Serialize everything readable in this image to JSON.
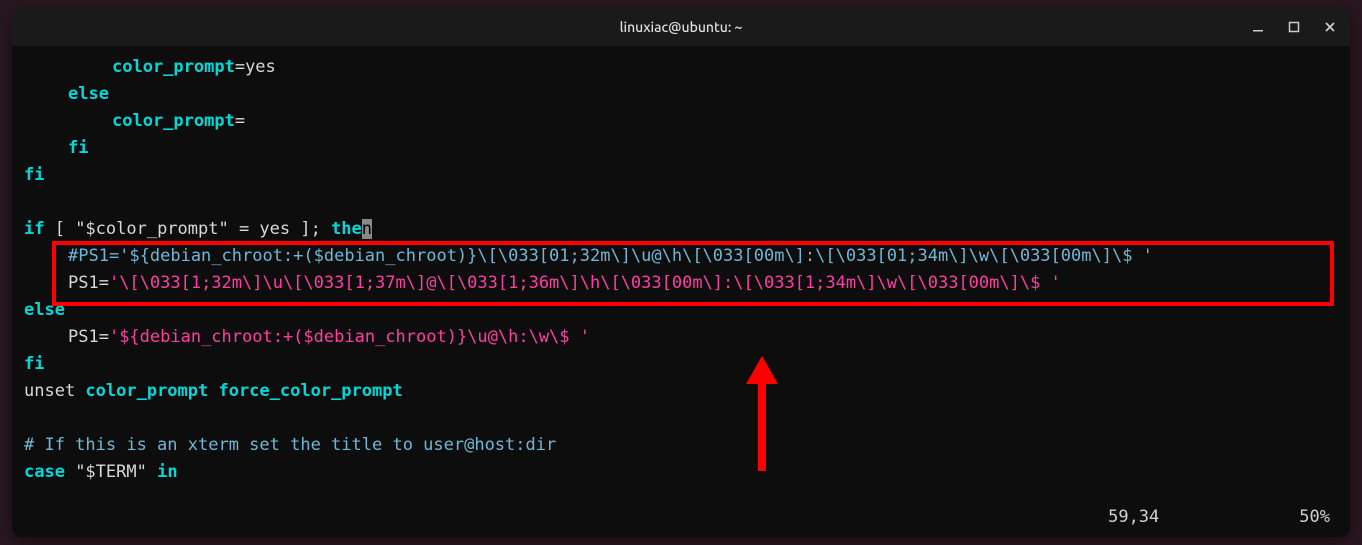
{
  "window": {
    "title": "linuxiac@ubuntu: ~"
  },
  "code": {
    "l1_var": "color_prompt",
    "l1_val": "=yes",
    "l2": "else",
    "l3_var": "color_prompt",
    "l3_val": "=",
    "l4": "fi",
    "l5": "fi",
    "l6_if": "if",
    "l6_cond": " [ \"$color_prompt\" = yes ]; ",
    "l6_then_pre": "the",
    "l6_then_cur": "n",
    "l7_comment": "#PS1='${debian_chroot:+($debian_chroot)}\\[\\033[01;32m\\]\\u@\\h\\[\\033[00m\\]:\\[\\033[01;34m\\]\\w\\[\\033[00m\\]\\$ '",
    "l8_pre": "PS1=",
    "l8_str": "'\\[\\033[1;32m\\]\\u\\[\\033[1;37m\\]@\\[\\033[1;36m\\]\\h\\[\\033[00m\\]:\\[\\033[1;34m\\]\\w\\[\\033[00m\\]\\$ '",
    "l9": "else",
    "l10_pre": "PS1=",
    "l10_str": "'${debian_chroot:+($debian_chroot)}\\u@\\h:\\w\\$ '",
    "l11": "fi",
    "l12_unset": "unset",
    "l12_vars": " color_prompt force_color_prompt",
    "l13_comment": "# If this is an xterm set the title to user@host:dir",
    "l14_case": "case",
    "l14_var": " \"$TERM\" ",
    "l14_in": "in"
  },
  "status": {
    "pos": "59,34",
    "pct": "50%"
  }
}
